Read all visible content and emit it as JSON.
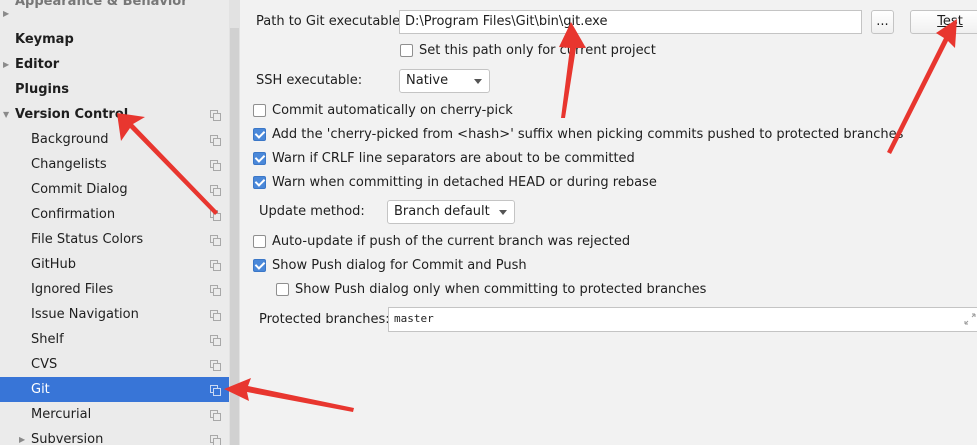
{
  "sidebar": {
    "items": [
      {
        "label": "Appearance & Behavior",
        "kind": "section",
        "expandable": true
      },
      {
        "label": "Keymap",
        "kind": "section"
      },
      {
        "label": "Editor",
        "kind": "section",
        "expandable": true
      },
      {
        "label": "Plugins",
        "kind": "section"
      },
      {
        "label": "Version Control",
        "kind": "section",
        "expanded": true
      },
      {
        "label": "Background"
      },
      {
        "label": "Changelists"
      },
      {
        "label": "Commit Dialog"
      },
      {
        "label": "Confirmation"
      },
      {
        "label": "File Status Colors"
      },
      {
        "label": "GitHub"
      },
      {
        "label": "Ignored Files"
      },
      {
        "label": "Issue Navigation"
      },
      {
        "label": "Shelf"
      },
      {
        "label": "CVS"
      },
      {
        "label": "Git",
        "selected": true
      },
      {
        "label": "Mercurial"
      },
      {
        "label": "Subversion",
        "expandable": true
      }
    ]
  },
  "git": {
    "path_label": "Path to Git executable:",
    "path_value": "D:\\Program Files\\Git\\bin\\git.exe",
    "browse_label": "...",
    "test_label": "Test",
    "path_project_only": {
      "label": "Set this path only for current project",
      "checked": false
    },
    "ssh_label": "SSH executable:",
    "ssh_value": "Native",
    "options": [
      {
        "label": "Commit automatically on cherry-pick",
        "checked": false
      },
      {
        "label": "Add the 'cherry-picked from <hash>' suffix when picking commits pushed to protected branches",
        "checked": true
      },
      {
        "label": "Warn if CRLF line separators are about to be committed",
        "checked": true
      },
      {
        "label": "Warn when committing in detached HEAD or during rebase",
        "checked": true
      }
    ],
    "update_label": "Update method:",
    "update_value": "Branch default",
    "push_options": [
      {
        "label": "Auto-update if push of the current branch was rejected",
        "checked": false
      },
      {
        "label": "Show Push dialog for Commit and Push",
        "checked": true
      },
      {
        "label": "Show Push dialog only when committing to protected branches",
        "checked": false
      }
    ],
    "protected_label": "Protected branches:",
    "protected_value": "master"
  },
  "colors": {
    "selection": "#3875d7",
    "annotation_arrow": "#e8362f",
    "checkbox_on": "#4a88d9"
  }
}
